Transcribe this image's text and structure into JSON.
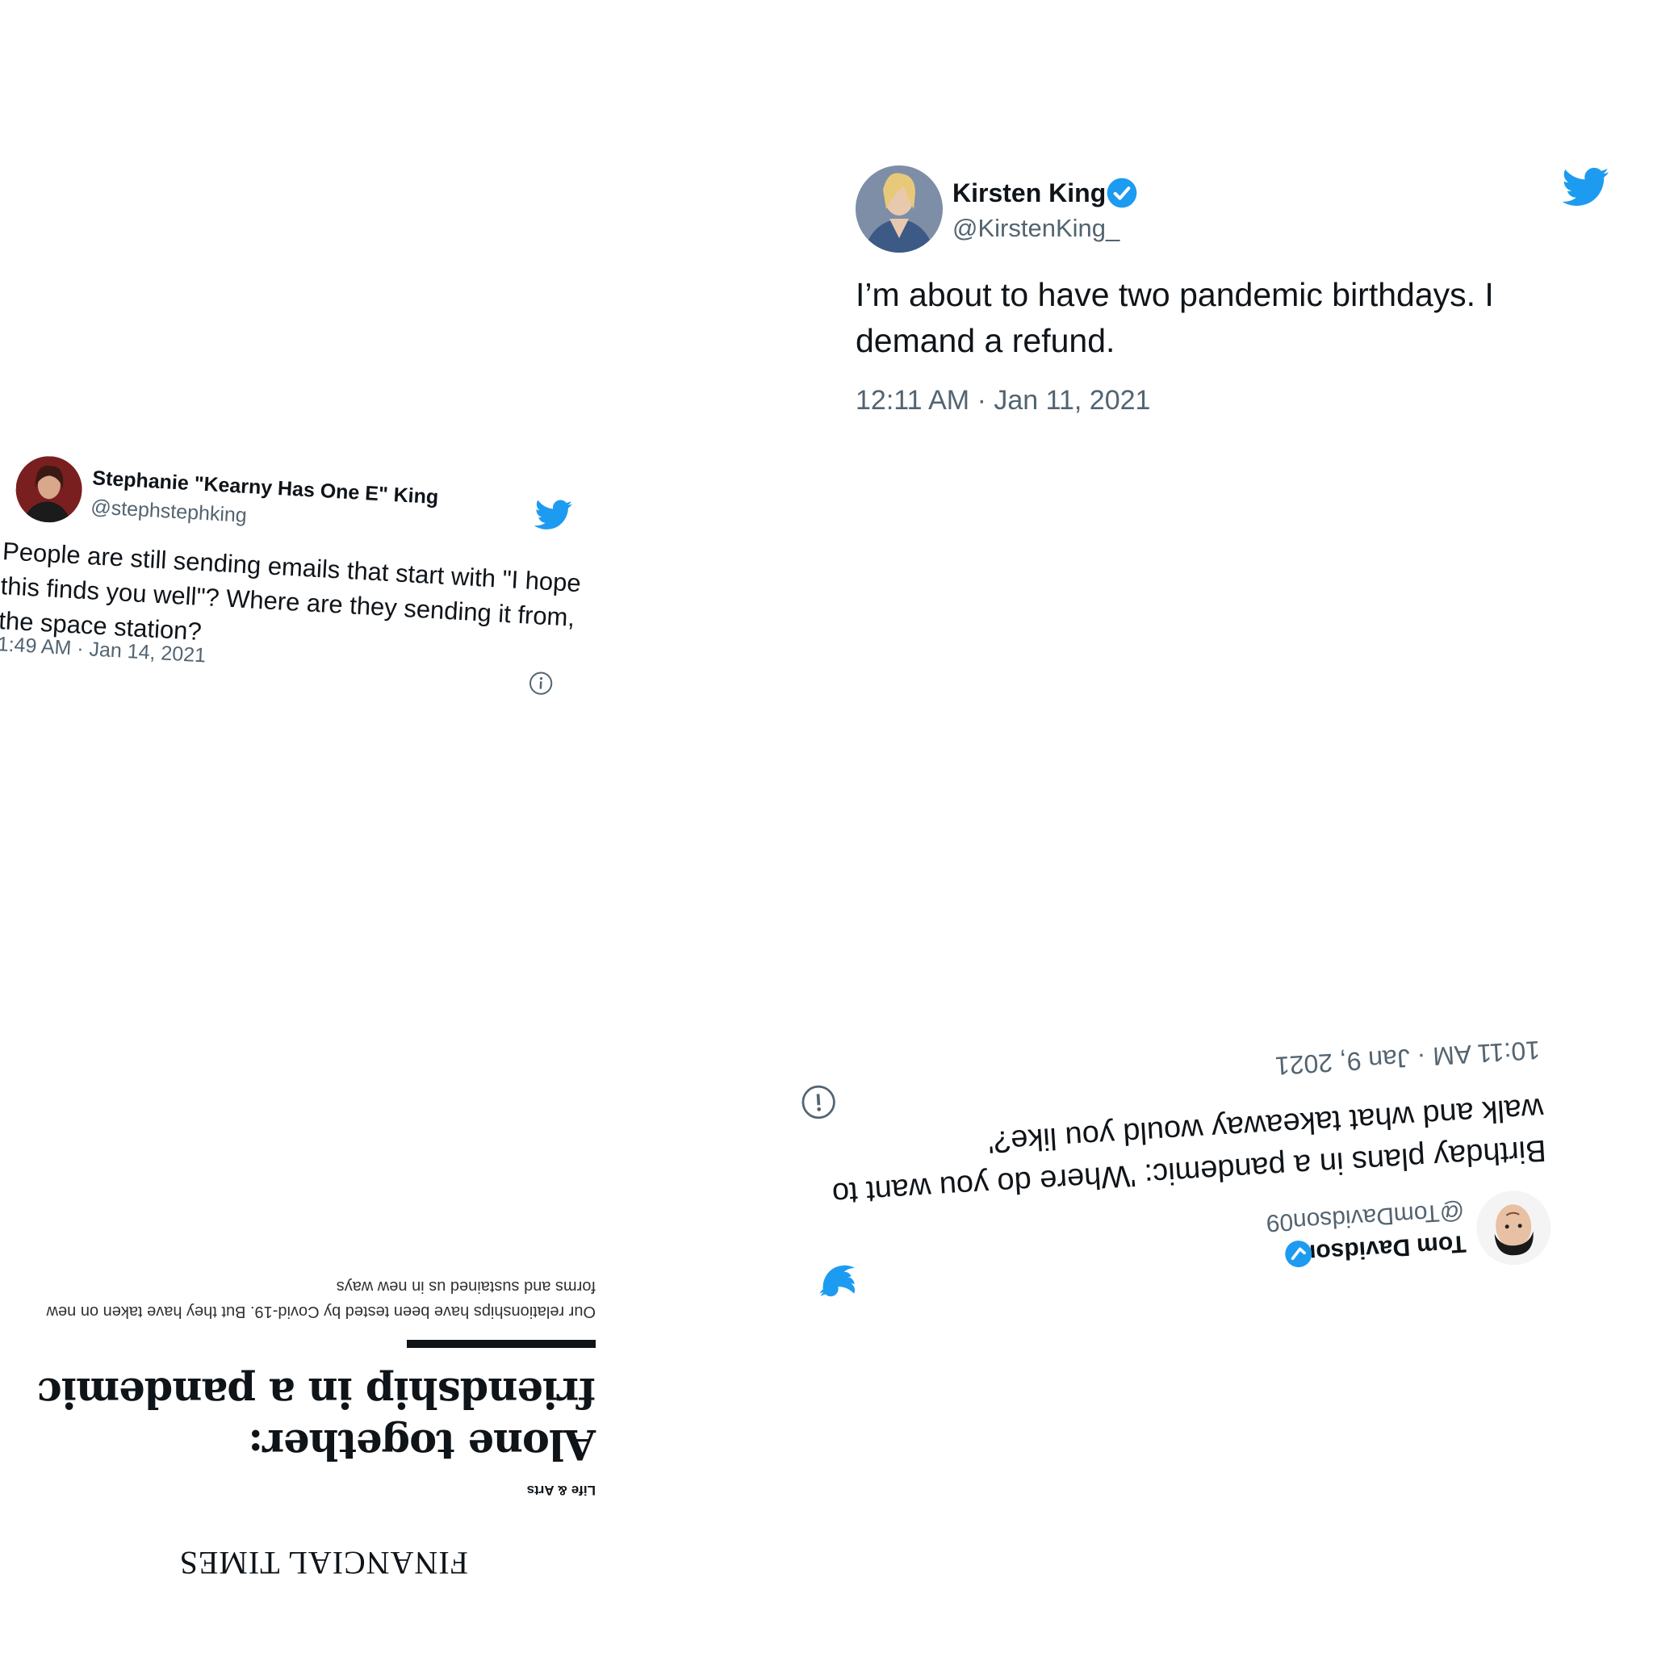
{
  "tweets": {
    "kirsten": {
      "name": "Kirsten King",
      "handle": "@KirstenKing_",
      "text": "I’m about to have two pandemic birthdays. I demand a refund.",
      "timestamp": "12:11 AM · Jan 11, 2021"
    },
    "stephanie": {
      "name": "Stephanie \"Kearny Has One E\" King",
      "handle": "@stephstephking",
      "text": "People are still sending emails that start with \"I hope this finds you well\"? Where are they sending it from, the space station?",
      "timestamp": "1:49 AM · Jan 14, 2021"
    },
    "tom": {
      "name": "Tom Davidson",
      "handle": "@TomDavidson09",
      "text": "Birthday plans in a pandemic: 'Where do you want to walk and what takeaway would you like?'",
      "timestamp": "10:11 AM · Jan 9, 2021"
    }
  },
  "article": {
    "brand": "FINANCIAL TIMES",
    "section": "Life & Arts",
    "headline": "Alone together: friendship in a pandemic",
    "standfirst": "Our relationships have been tested by Covid-19. But they have taken on new forms and sustained us in new ways"
  },
  "icons": {
    "brand_bird": "twitter-bird-icon",
    "verified": "verified-badge-icon",
    "info": "info-icon"
  },
  "colors": {
    "twitter_blue": "#1d9bf0",
    "text": "#0f1419",
    "muted": "#536471"
  }
}
